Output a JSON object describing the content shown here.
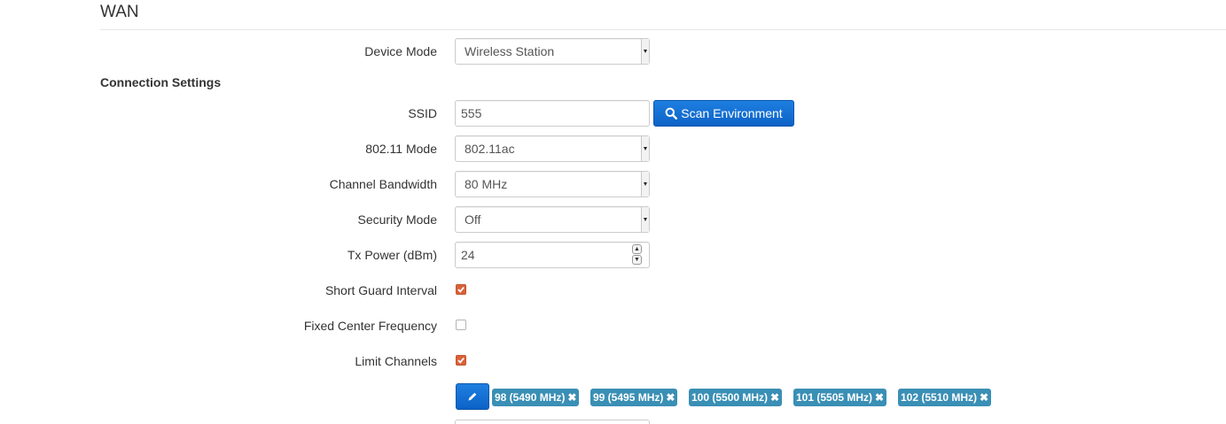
{
  "section": {
    "title": "WAN"
  },
  "device_mode": {
    "label": "Device Mode",
    "value": "Wireless Station"
  },
  "connection_settings": {
    "title": "Connection Settings",
    "ssid": {
      "label": "SSID",
      "value": "555"
    },
    "scan_button": {
      "label": "Scan Environment",
      "icon": "search-icon"
    },
    "mode_80211": {
      "label": "802.11 Mode",
      "value": "802.11ac"
    },
    "channel_bandwidth": {
      "label": "Channel Bandwidth",
      "value": "80 MHz"
    },
    "security_mode": {
      "label": "Security Mode",
      "value": "Off"
    },
    "tx_power": {
      "label": "Tx Power (dBm)",
      "value": "24"
    },
    "short_guard_interval": {
      "label": "Short Guard Interval",
      "checked": true
    },
    "fixed_center_frequency": {
      "label": "Fixed Center Frequency",
      "checked": false
    },
    "limit_channels": {
      "label": "Limit Channels",
      "checked": true
    },
    "channels": {
      "edit_icon": "pencil-icon",
      "tags": [
        "98 (5490 MHz)",
        "99 (5495 MHz)",
        "100 (5500 MHz)",
        "101 (5505 MHz)",
        "102 (5510 MHz)"
      ],
      "remove_icon": "close-icon"
    }
  },
  "colors": {
    "primary_button": "#0d62c7",
    "checkbox_checked": "#d9623a",
    "tag_background": "#3a8fb5"
  }
}
